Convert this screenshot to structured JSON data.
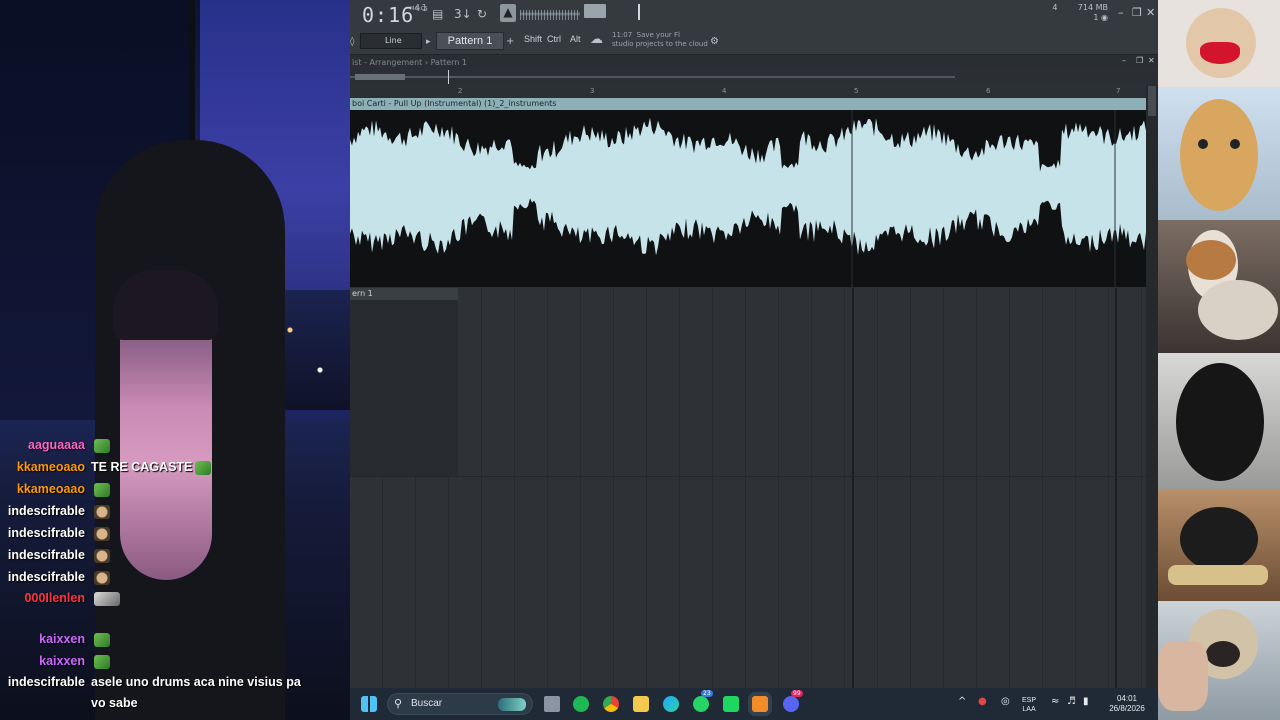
{
  "daw": {
    "time": "0:16",
    "time_small": "41",
    "time_label": "M:S:CS",
    "memory": "714 MB",
    "cpu_count": "4",
    "voices": "1",
    "line_mode": "Line",
    "pattern": "Pattern 1",
    "mod_keys": [
      "Shift",
      "Ctrl",
      "Alt"
    ],
    "hint_time": "11:07",
    "hint_text_1": "Save your Fl",
    "hint_text_2": "studio projects to the cloud",
    "playlist_title": "ist - Arrangement › Pattern 1",
    "ruler_marks": [
      "2",
      "3",
      "4",
      "5",
      "6",
      "7"
    ],
    "clip_name": "boi Carti - Pull Up (Instrumental) (1)_2_instruments",
    "pattern_clip_label": "ern 1",
    "accent_color": "#8db0b7"
  },
  "chat": [
    {
      "user": "aaguaaaa",
      "color": "#ff66cc",
      "msg": "",
      "emote": "green"
    },
    {
      "user": "kkameoaao",
      "color": "#ff9900",
      "msg": "TE RE CAGASTE",
      "emote": "green"
    },
    {
      "user": "kkameoaao",
      "color": "#ff9900",
      "msg": "",
      "emote": "green"
    },
    {
      "user": "indescifrable",
      "color": "#ffffff",
      "msg": "",
      "emote": "face"
    },
    {
      "user": "indescifrable",
      "color": "#ffffff",
      "msg": "",
      "emote": "face"
    },
    {
      "user": "indescifrable",
      "color": "#ffffff",
      "msg": "",
      "emote": "face"
    },
    {
      "user": "indescifrable",
      "color": "#ffffff",
      "msg": "",
      "emote": "face"
    },
    {
      "user": "000Ilenlen",
      "color": "#ff3344",
      "msg": "",
      "emote": "gray"
    },
    {
      "user": "kaixxen",
      "color": "#cc66ff",
      "msg": "",
      "emote": "green"
    },
    {
      "user": "kaixxen",
      "color": "#cc66ff",
      "msg": "",
      "emote": "green"
    },
    {
      "user": "indescifrable",
      "color": "#ffffff",
      "msg": "asele uno drums aca nine visius pa",
      "emote": ""
    },
    {
      "user": "",
      "color": "#ffffff",
      "msg": "vo sabe",
      "emote": ""
    }
  ],
  "taskbar": {
    "search_placeholder": "Buscar",
    "lang_1": "ESP",
    "lang_2": "LAA",
    "clock_time": "04:01",
    "clock_date": "26/8/2026",
    "whatsapp_badge": "23",
    "discord_badge": "99"
  }
}
